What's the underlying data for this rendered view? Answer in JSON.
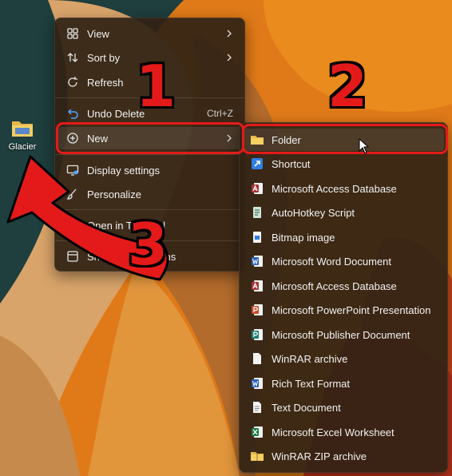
{
  "desktop": {
    "icon_label": "Glacier"
  },
  "context_menu": {
    "items": [
      {
        "label": "View",
        "icon": "grid-icon",
        "has_submenu": true
      },
      {
        "label": "Sort by",
        "icon": "sort-icon",
        "has_submenu": true
      },
      {
        "label": "Refresh",
        "icon": "refresh-icon"
      },
      {
        "label": "Undo Delete",
        "icon": "undo-icon",
        "shortcut": "Ctrl+Z"
      },
      {
        "label": "New",
        "icon": "plus-circle-icon",
        "has_submenu": true
      },
      {
        "label": "Display settings",
        "icon": "display-icon"
      },
      {
        "label": "Personalize",
        "icon": "brush-icon"
      },
      {
        "label": "Open in Terminal",
        "icon": "terminal-icon"
      },
      {
        "label": "Show more options",
        "icon": "more-options-icon"
      }
    ]
  },
  "new_submenu": {
    "items": [
      {
        "label": "Folder",
        "icon": "folder-icon"
      },
      {
        "label": "Shortcut",
        "icon": "shortcut-icon"
      },
      {
        "label": "Microsoft Access Database",
        "icon": "access-icon"
      },
      {
        "label": "AutoHotkey Script",
        "icon": "script-icon"
      },
      {
        "label": "Bitmap image",
        "icon": "bitmap-icon"
      },
      {
        "label": "Microsoft Word Document",
        "icon": "word-icon"
      },
      {
        "label": "Microsoft Access Database",
        "icon": "access-icon"
      },
      {
        "label": "Microsoft PowerPoint Presentation",
        "icon": "powerpoint-icon"
      },
      {
        "label": "Microsoft Publisher Document",
        "icon": "publisher-icon"
      },
      {
        "label": "WinRAR archive",
        "icon": "file-icon"
      },
      {
        "label": "Rich Text Format",
        "icon": "word-icon"
      },
      {
        "label": "Text Document",
        "icon": "text-file-icon"
      },
      {
        "label": "Microsoft Excel Worksheet",
        "icon": "excel-icon"
      },
      {
        "label": "WinRAR ZIP archive",
        "icon": "zip-folder-icon"
      }
    ]
  },
  "annotations": {
    "step1": "1",
    "step2": "2",
    "step3": "3"
  },
  "colors": {
    "annotation_red": "#e41a1a",
    "menu_bg": "#302214"
  }
}
